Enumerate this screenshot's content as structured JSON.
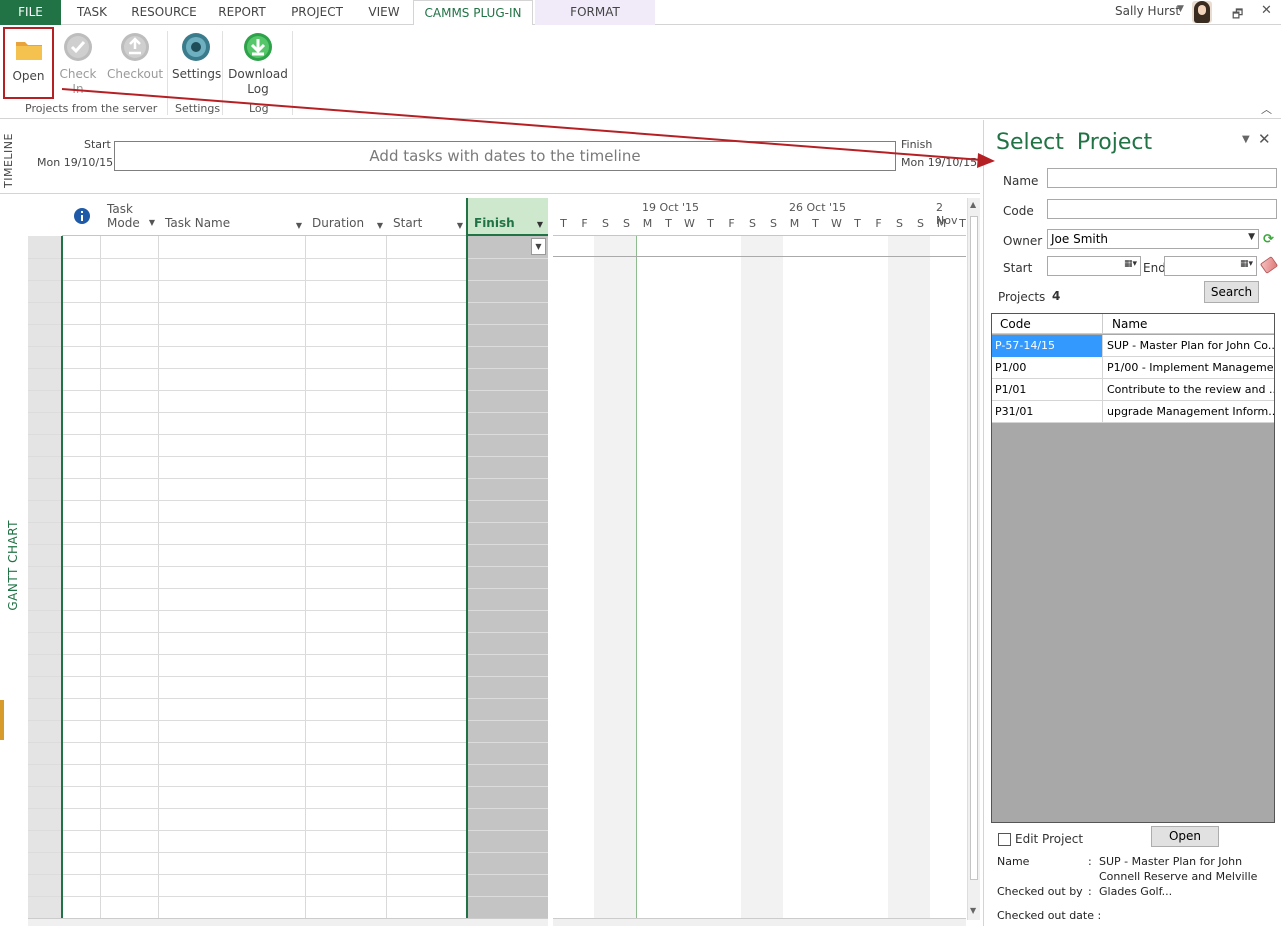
{
  "tabs": [
    "FILE",
    "TASK",
    "RESOURCE",
    "REPORT",
    "PROJECT",
    "VIEW",
    "CAMMS PLUG-IN",
    "FORMAT"
  ],
  "user": {
    "name": "Sally Hurst"
  },
  "ribbon": {
    "open_label": "Open",
    "checkin_label": "Check In",
    "checkout_label": "Checkout",
    "settings_label": "Settings",
    "download_label": "Download Log",
    "groups": {
      "server": "Projects from the server",
      "settings": "Settings",
      "log": "Log"
    }
  },
  "timeline": {
    "label": "TIMELINE",
    "start_label": "Start",
    "start_date": "Mon 19/10/15",
    "placeholder": "Add tasks with dates to the timeline",
    "finish_label": "Finish",
    "finish_date": "Mon 19/10/15"
  },
  "gantt": {
    "side_label": "GANTT CHART",
    "columns": {
      "task_mode": "Task Mode",
      "task_name": "Task Name",
      "duration": "Duration",
      "start": "Start",
      "finish": "Finish"
    },
    "weeks": [
      "19 Oct '15",
      "26 Oct '15",
      "2 Nov"
    ],
    "days": [
      "T",
      "F",
      "S",
      "S",
      "M",
      "T",
      "W",
      "T",
      "F",
      "S",
      "S",
      "M",
      "T",
      "W",
      "T",
      "F",
      "S",
      "S",
      "M",
      "T"
    ]
  },
  "panel": {
    "title": "Select  Project",
    "name_label": "Name",
    "code_label": "Code",
    "owner_label": "Owner",
    "owner_value": "Joe Smith",
    "start_label": "Start",
    "end_label": "End",
    "projects_label": "Projects",
    "projects_count": "4",
    "search_label": "Search",
    "table_headers": {
      "code": "Code",
      "name": "Name"
    },
    "rows": [
      {
        "code": "P-57-14/15",
        "name": "SUP - Master Plan for John Co..."
      },
      {
        "code": "P1/00",
        "name": "P1/00 - Implement Manageme..."
      },
      {
        "code": "P1/01",
        "name": "Contribute to the review and ..."
      },
      {
        "code": "P31/01",
        "name": "upgrade Management Inform..."
      }
    ],
    "edit_project_label": "Edit Project",
    "open_label": "Open",
    "info": {
      "name_label": "Name",
      "name_value": "SUP - Master Plan for John Connell Reserve and Melville Glades Golf...",
      "checked_out_by_label": "Checked out by",
      "checked_out_date_label": "Checked out date :",
      "colon": ":"
    }
  },
  "colors": {
    "accent": "#217346",
    "highlight": "#b52025",
    "selection": "#3399ff"
  }
}
